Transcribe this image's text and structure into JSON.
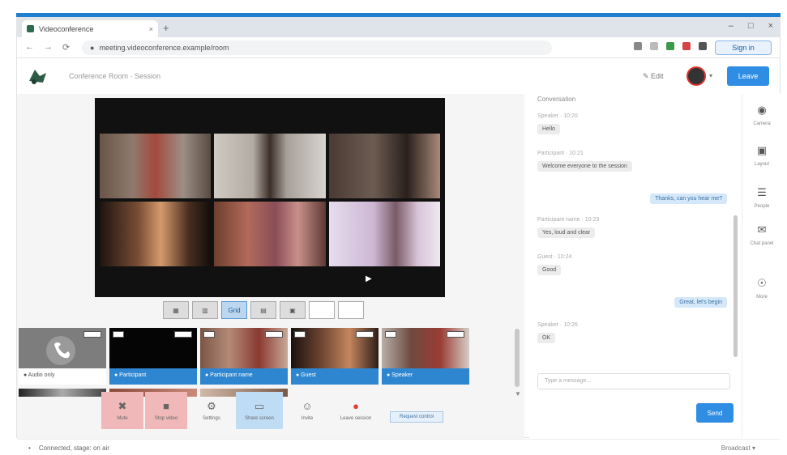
{
  "browser": {
    "tab_title": "Videoconference",
    "tab_close": "×",
    "new_tab": "+",
    "window_controls": [
      "–",
      "□",
      "×"
    ],
    "nav": [
      "←",
      "→",
      "⟳"
    ],
    "url": "meeting.videoconference.example/room",
    "profile_button": "Sign in"
  },
  "app": {
    "title": "Conference Room · Session",
    "edit_label": "✎ Edit",
    "avatar_caret": "▾",
    "leave_button": "Leave"
  },
  "layout_buttons": [
    {
      "label": "▦",
      "active": false
    },
    {
      "label": "▥",
      "active": false
    },
    {
      "label": "Grid",
      "active": true
    },
    {
      "label": "▤",
      "active": false
    },
    {
      "label": "▣",
      "active": false
    },
    {
      "label": "",
      "active": false
    },
    {
      "label": "",
      "active": false
    }
  ],
  "thumbnails": [
    {
      "label": "● Audio only",
      "style": "gray"
    },
    {
      "label": "● Participant",
      "style": "blue"
    },
    {
      "label": "● Participant name",
      "style": "blue"
    },
    {
      "label": "● Guest",
      "style": "blue"
    },
    {
      "label": "● Speaker",
      "style": "blue"
    }
  ],
  "toolbar": [
    {
      "icon": "✖",
      "label": "Mute",
      "style": "red"
    },
    {
      "icon": "■",
      "label": "Stop video",
      "style": "red"
    },
    {
      "icon": "⚙",
      "label": "Settings",
      "style": ""
    },
    {
      "icon": "▭",
      "label": "Share screen",
      "style": "blue"
    },
    {
      "icon": "☺",
      "label": "Invite",
      "style": ""
    },
    {
      "icon": "●",
      "label": "Leave session",
      "style": ""
    }
  ],
  "toolbar_pill": "Request control",
  "chat": {
    "header": "Conversation",
    "messages": [
      {
        "meta": "Speaker · 10:20",
        "text": "Hello"
      },
      {
        "meta": "Participant · 10:21",
        "text": "Welcome everyone to the session"
      },
      {
        "mine": true,
        "text": "Thanks, can you hear me?"
      },
      {
        "meta": "Participant name · 10:23",
        "text": "Yes, loud and clear"
      },
      {
        "meta": "Guest · 10:24",
        "text": "Good"
      },
      {
        "mine": true,
        "text": "Great, let's begin"
      },
      {
        "meta": "Speaker · 10:26",
        "text": "OK"
      }
    ],
    "input_placeholder": "Type a message...",
    "send_button": "Send"
  },
  "rail": [
    {
      "icon": "◉",
      "label": "Camera"
    },
    {
      "icon": "▣",
      "label": "Layout"
    },
    {
      "icon": "☰",
      "label": "People"
    },
    {
      "icon": "✉",
      "label": "Chat panel"
    },
    {
      "icon": "☉",
      "label": "More"
    }
  ],
  "status": {
    "left": "Connected, stage: on air",
    "left_icon": "•",
    "right": "Broadcast ▾"
  },
  "colors": {
    "accent": "#2f8de4",
    "topband": "#1e7fd0",
    "stop_red": "#f0b8b8",
    "active_blue": "#bfdcf5"
  }
}
